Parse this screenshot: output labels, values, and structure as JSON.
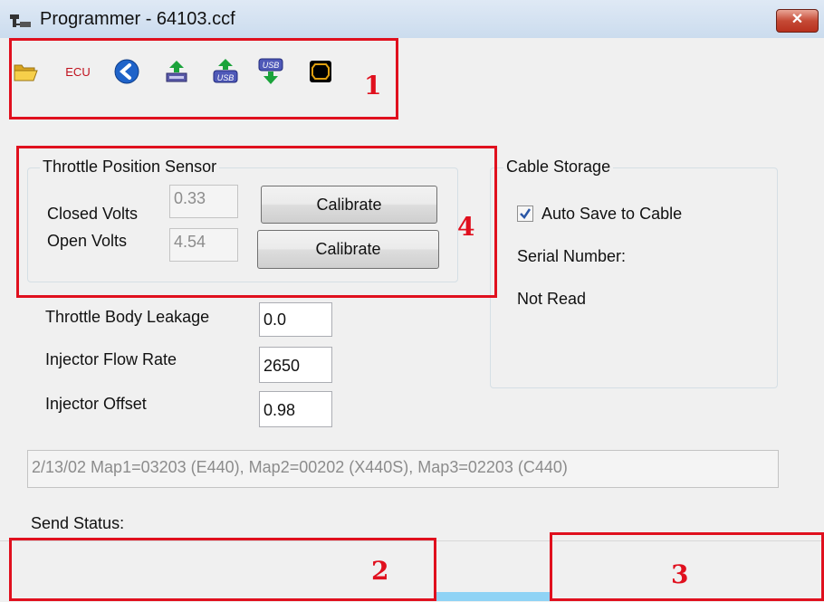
{
  "window": {
    "title": "Programmer - 64103.ccf",
    "close_label": "✕"
  },
  "toolbar": {
    "icons": [
      {
        "name": "open-folder-icon"
      },
      {
        "name": "ecu-button",
        "label": "ECU"
      },
      {
        "name": "back-arrow-icon"
      },
      {
        "name": "upload-map-icon"
      },
      {
        "name": "upload-usb-icon"
      },
      {
        "name": "download-usb-icon"
      },
      {
        "name": "monitor-icon"
      }
    ]
  },
  "tps": {
    "title": "Throttle Position Sensor",
    "closed_label": "Closed Volts",
    "closed_value": "0.33",
    "open_label": "Open Volts",
    "open_value": "4.54",
    "calibrate_label": "Calibrate"
  },
  "fields": {
    "leakage_label": "Throttle Body Leakage",
    "leakage_value": "0.0",
    "flow_label": "Injector Flow Rate",
    "flow_value": "2650",
    "offset_label": "Injector Offset",
    "offset_value": "0.98"
  },
  "cable": {
    "title": "Cable Storage",
    "autosave_label": "Auto Save to Cable",
    "autosave_checked": true,
    "serial_label": "Serial Number:",
    "serial_value": "Not Read"
  },
  "map_info": "2/13/02  Map1=03203 (E440), Map2=00202 (X440S), Map3=02203 (C440)",
  "send_status_label": "Send Status:",
  "annotations": [
    "1",
    "2",
    "3",
    "4"
  ]
}
